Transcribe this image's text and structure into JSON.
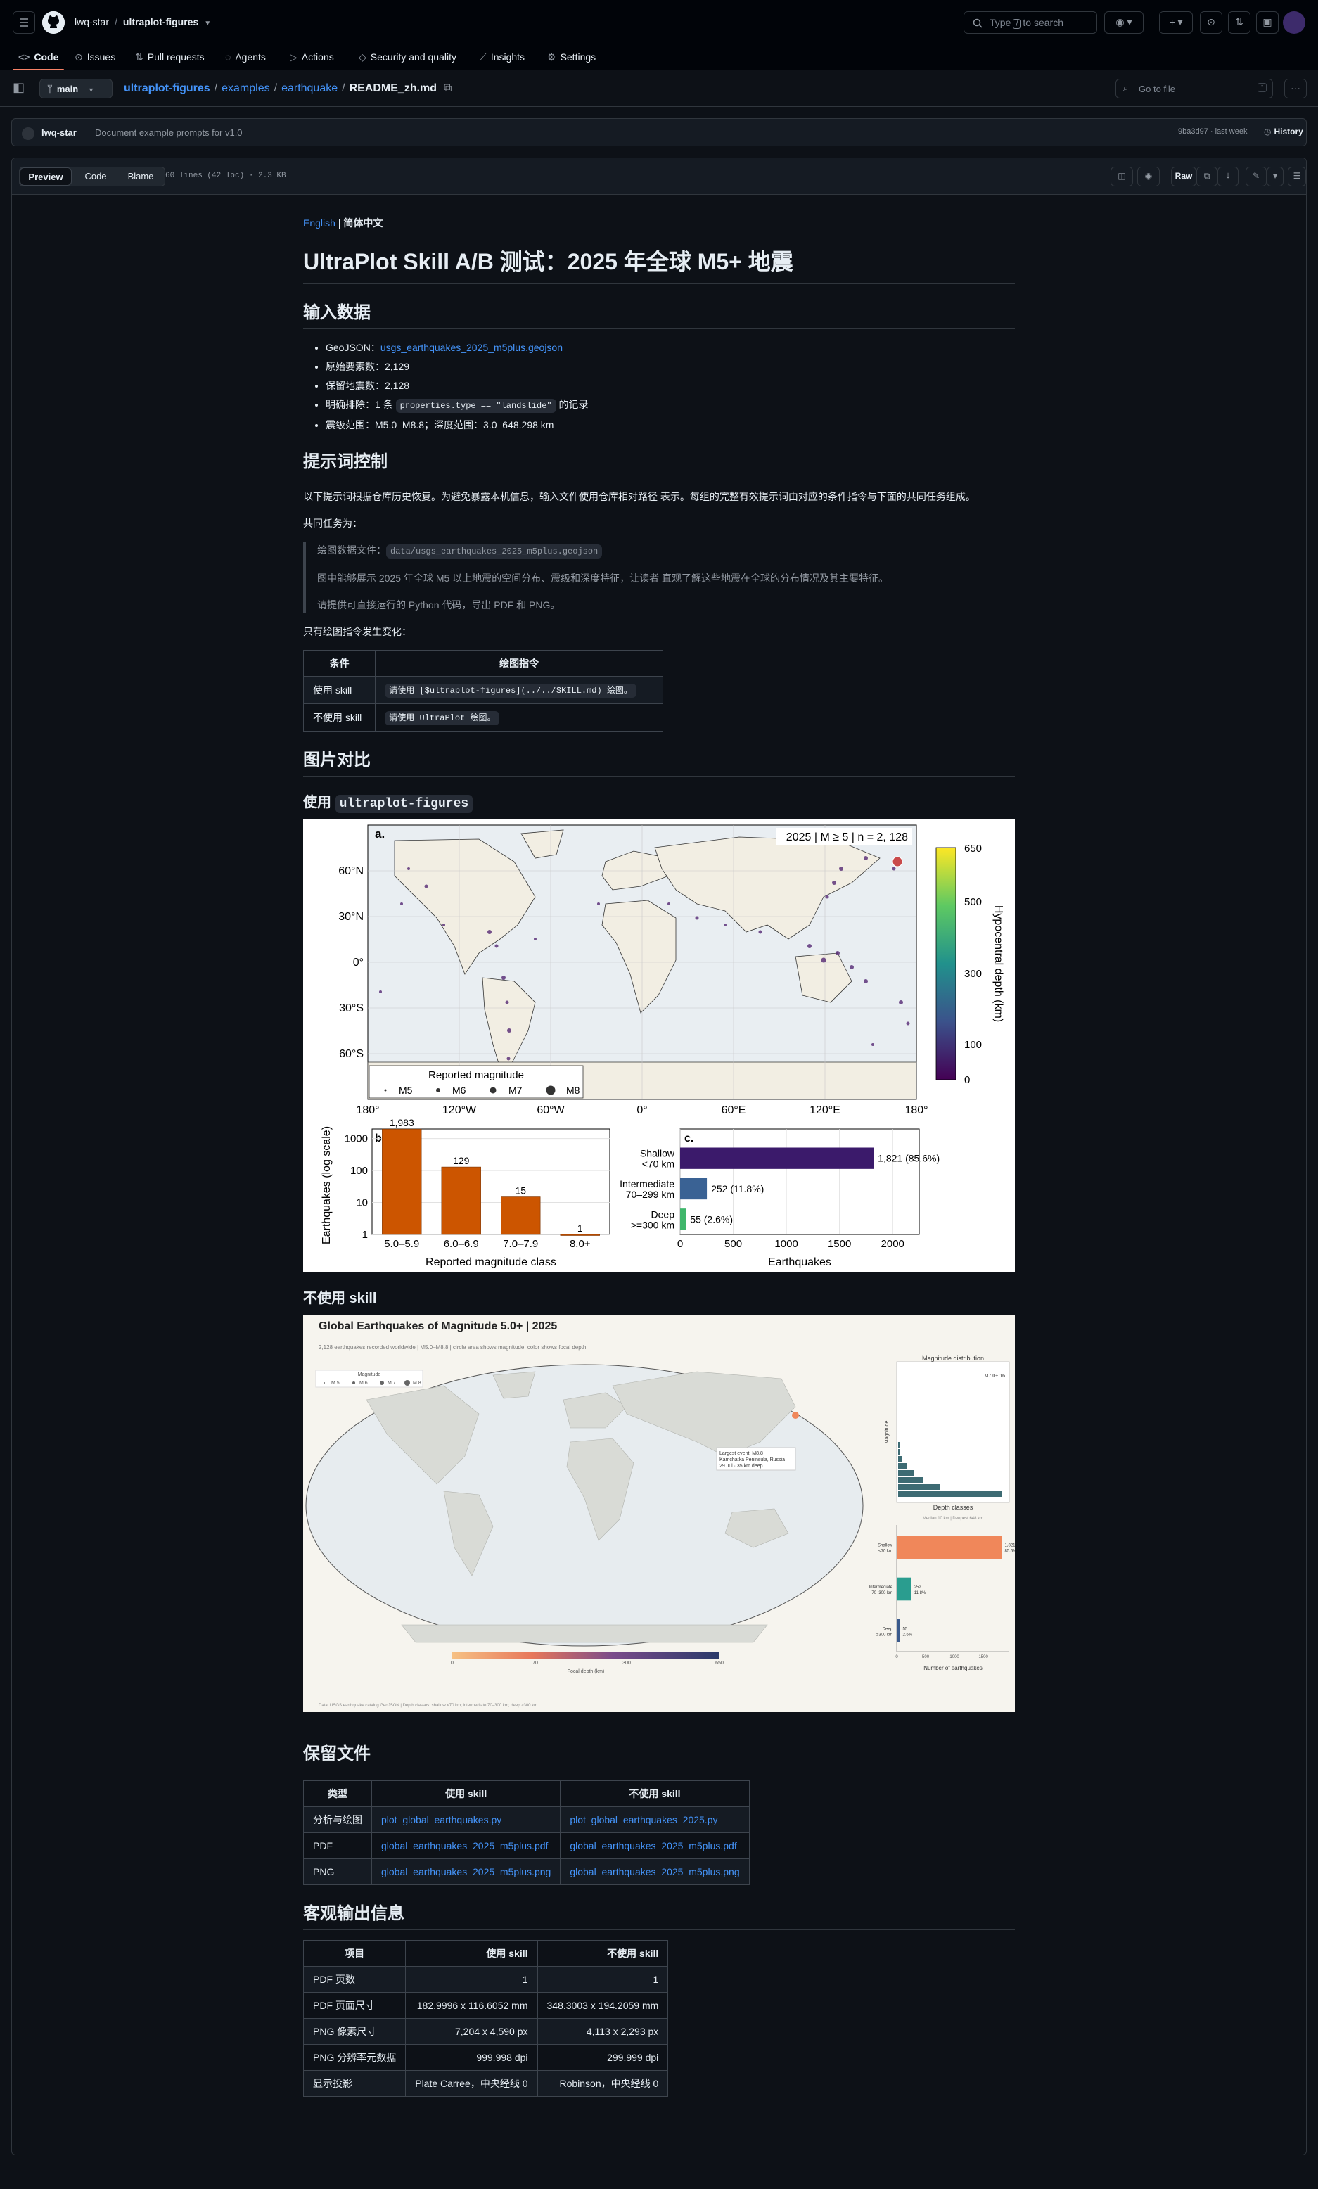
{
  "header": {
    "owner": "lwq-star",
    "repo": "ultraplot-figures",
    "search_placeholder_before": "Type",
    "search_key": "/",
    "search_placeholder_after": "to search",
    "tabs": [
      {
        "label": "Code",
        "icon": "code-icon"
      },
      {
        "label": "Issues",
        "icon": "issue-icon"
      },
      {
        "label": "Pull requests",
        "icon": "pull-request-icon"
      },
      {
        "label": "Agents",
        "icon": "agents-icon"
      },
      {
        "label": "Actions",
        "icon": "play-icon"
      },
      {
        "label": "Security and quality",
        "icon": "shield-icon"
      },
      {
        "label": "Insights",
        "icon": "graph-icon"
      },
      {
        "label": "Settings",
        "icon": "gear-icon"
      }
    ]
  },
  "file_nav": {
    "branch": "main",
    "path": [
      "ultraplot-figures",
      "examples",
      "earthquake"
    ],
    "file": "README_zh.md",
    "goto_placeholder": "Go to file",
    "goto_key": "t"
  },
  "commit": {
    "author": "lwq-star",
    "message": "Document example prompts for v1.0",
    "meta": "9ba3d97 · last week",
    "history": "History"
  },
  "file_toolbar": {
    "preview": "Preview",
    "code": "Code",
    "blame": "Blame",
    "info": "60 lines (42 loc) · 2.3 KB",
    "raw": "Raw"
  },
  "readme": {
    "lang_en": "English",
    "lang_sep": " | ",
    "lang_zh": "简体中文",
    "title": "UltraPlot Skill A/B 测试：2025 年全球 M5+ 地震",
    "input": {
      "heading": "输入数据",
      "geojson_label": "GeoJSON：",
      "geojson_link": "usgs_earthquakes_2025_m5plus.geojson",
      "orig_count": "原始要素数：2,129",
      "kept_count": "保留地震数：2,128",
      "exclude_pre": "明确排除：1 条 ",
      "exclude_code": "properties.type == \"landslide\"",
      "exclude_post": " 的记录",
      "ranges": "震级范围：M5.0–M8.8；深度范围：3.0–648.298 km"
    },
    "prompt": {
      "heading": "提示词控制",
      "intro": "以下提示词根据仓库历史恢复。为避免暴露本机信息，输入文件使用仓库相对路径 表示。每组的完整有效提示词由对应的条件指令与下面的共同任务组成。",
      "common": "共同任务为：",
      "quote_label": "绘图数据文件：",
      "quote_code": "data/usgs_earthquakes_2025_m5plus.geojson",
      "quote_line2": "图中能够展示 2025 年全球 M5 以上地震的空间分布、震级和深度特征，让读者 直观了解这些地震在全球的分布情况及其主要特征。",
      "quote_line3": "请提供可直接运行的 Python 代码，导出 PDF 和 PNG。",
      "only_change": "只有绘图指令发生变化：",
      "table_headers": [
        "条件",
        "绘图指令"
      ],
      "rows": [
        {
          "cond": "使用 skill",
          "code": "请使用 [$ultraplot-figures](../../SKILL.md) 绘图。"
        },
        {
          "cond": "不使用 skill",
          "code": "请使用 UltraPlot 绘图。"
        }
      ]
    },
    "compare": {
      "heading": "图片对比",
      "with_pre": "使用 ",
      "with_code": "ultraplot-figures",
      "without": "不使用 skill"
    },
    "files": {
      "heading": "保留文件",
      "headers": [
        "类型",
        "使用 skill",
        "不使用 skill"
      ],
      "rows": [
        {
          "type": "分析与绘图",
          "a": "plot_global_earthquakes.py",
          "b": "plot_global_earthquakes_2025.py"
        },
        {
          "type": "PDF",
          "a": "global_earthquakes_2025_m5plus.pdf",
          "b": "global_earthquakes_2025_m5plus.pdf"
        },
        {
          "type": "PNG",
          "a": "global_earthquakes_2025_m5plus.png",
          "b": "global_earthquakes_2025_m5plus.png"
        }
      ]
    },
    "output": {
      "heading": "客观输出信息",
      "headers": [
        "项目",
        "使用 skill",
        "不使用 skill"
      ],
      "rows": [
        {
          "item": "PDF 页数",
          "a": "1",
          "b": "1"
        },
        {
          "item": "PDF 页面尺寸",
          "a": "182.9996 x 116.6052 mm",
          "b": "348.3003 x 194.2059 mm"
        },
        {
          "item": "PNG 像素尺寸",
          "a": "7,204 x 4,590 px",
          "b": "4,113 x 2,293 px"
        },
        {
          "item": "PNG 分辨率元数据",
          "a": "999.998 dpi",
          "b": "299.999 dpi"
        },
        {
          "item": "显示投影",
          "a": "Plate Carree，中央经线 0",
          "b": "Robinson，中央经线 0"
        }
      ]
    }
  },
  "figure_a": {
    "map": {
      "panel": "a.",
      "corner": "2025  |  M ≥ 5  |  n = 2, 128",
      "lat_ticks": [
        "60°N",
        "30°N",
        "0°",
        "30°S",
        "60°S"
      ],
      "lon_ticks": [
        "180°",
        "120°W",
        "60°W",
        "0°",
        "60°E",
        "120°E",
        "180°"
      ],
      "legend_title": "Reported magnitude",
      "legend": [
        "M5",
        "M6",
        "M7",
        "M8"
      ],
      "colorbar_label": "Hypocentral depth (km)",
      "colorbar_ticks": [
        "650",
        "500",
        "300",
        "100",
        "0"
      ]
    },
    "chart_data": [
      {
        "type": "bar",
        "panel": "b.",
        "categories": [
          "5.0–5.9",
          "6.0–6.9",
          "7.0–7.9",
          "8.0+"
        ],
        "values": [
          1983,
          129,
          15,
          1
        ],
        "value_labels": [
          "1,983",
          "129",
          "15",
          "1"
        ],
        "xlabel": "Reported magnitude class",
        "ylabel": "Earthquakes (log scale)",
        "yscale": "log",
        "yticks": [
          "1",
          "10",
          "100",
          "1000"
        ],
        "ylim": [
          1,
          2000
        ],
        "grid": true,
        "color": "#cc5500"
      },
      {
        "type": "bar",
        "orientation": "horizontal",
        "panel": "c.",
        "categories": [
          [
            "Shallow",
            "<70 km"
          ],
          [
            "Intermediate",
            "70–299 km"
          ],
          [
            "Deep",
            ">=300 km"
          ]
        ],
        "values": [
          1821,
          252,
          55
        ],
        "value_labels": [
          "1,821  (85.6%)",
          "252  (11.8%)",
          "55  (2.6%)"
        ],
        "colors": [
          "#3b1a6b",
          "#3a6294",
          "#3fb66b"
        ],
        "xlabel": "Earthquakes",
        "xticks": [
          "0",
          "500",
          "1000",
          "1500",
          "2000"
        ],
        "xlim": [
          0,
          2250
        ],
        "grid": true
      }
    ]
  },
  "figure_b": {
    "title": "Global Earthquakes of Magnitude 5.0+ | 2025",
    "subtitle": "2,128 earthquakes recorded worldwide | M5.0–M8.8 | circle area shows magnitude, color shows focal depth",
    "legend_title": "Magnitude",
    "legend": [
      "M 5",
      "M 6",
      "M 7",
      "M 8"
    ],
    "annotation": [
      "Largest event: M8.8",
      "Kamchatka Peninsula, Russia",
      "29 Jul · 35 km deep"
    ],
    "colorbar_label": "Focal depth (km)",
    "colorbar_ticks": [
      "0",
      "70",
      "300",
      "650"
    ],
    "footer": "Data: USGS earthquake catalog GeoJSON | Depth classes: shallow <70 km; intermediate 70–300 km; deep ≥300 km",
    "chart_data": [
      {
        "type": "bar",
        "orientation": "horizontal",
        "title": "Magnitude distribution",
        "note": "M7.0+   16",
        "ylabel": "Magnitude",
        "color": "#3d6b73"
      },
      {
        "type": "bar",
        "orientation": "horizontal",
        "title": "Depth classes",
        "note": "Median 10 km | Deepest 648 km",
        "categories": [
          [
            "Shallow",
            "<70 km"
          ],
          [
            "Intermediate",
            "70–300 km"
          ],
          [
            "Deep",
            "≥300 km"
          ]
        ],
        "values": [
          1821,
          252,
          55
        ],
        "value_labels": [
          [
            "1,821",
            "85.6%"
          ],
          [
            "252",
            "11.8%"
          ],
          [
            "55",
            "2.6%"
          ]
        ],
        "colors": [
          "#f0875a",
          "#2a9d8f",
          "#3a5a8c"
        ],
        "xlabel": "Number of earthquakes",
        "xticks": [
          "0",
          "500",
          "1000",
          "1500"
        ],
        "xlim": [
          0,
          1900
        ]
      }
    ]
  }
}
